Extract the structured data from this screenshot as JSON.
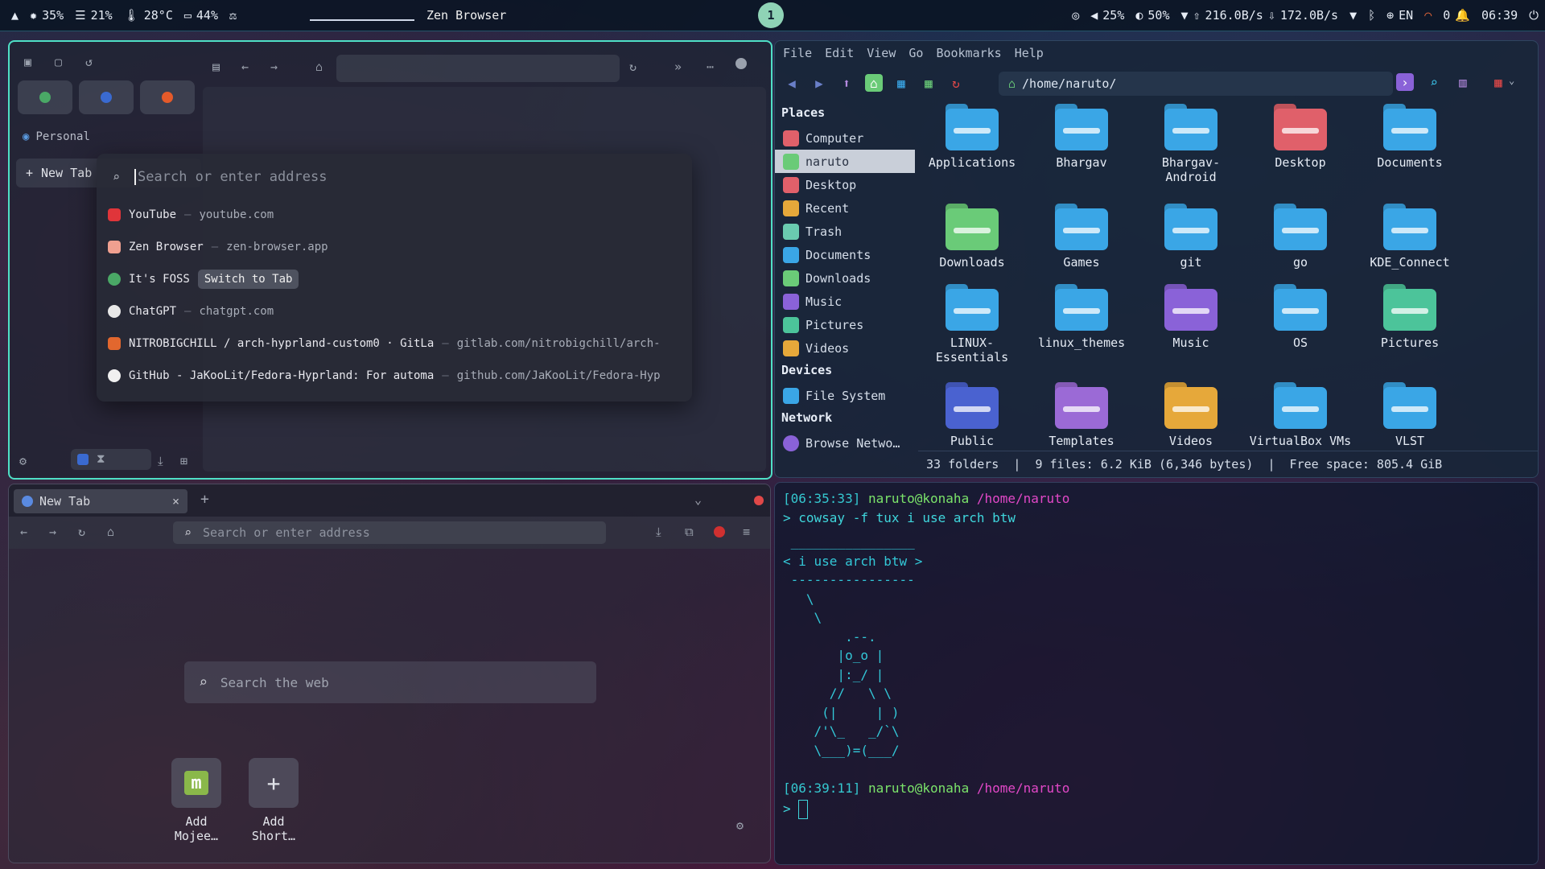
{
  "topbar": {
    "cpu": "35%",
    "mem": "21%",
    "temp": "28°C",
    "battery": "44%",
    "window_title": "Zen Browser",
    "workspace": "1",
    "volume": "25%",
    "brightness": "50%",
    "net_down": "216.0B/s",
    "net_up": "172.0B/s",
    "lang": "EN",
    "notifications": "0",
    "clock": "06:39"
  },
  "zen": {
    "workspace_label": "Personal",
    "new_tab_label": "New Tab",
    "search_placeholder": "Search or enter address",
    "suggestions": [
      {
        "title": "YouTube",
        "url": "youtube.com",
        "color": "#e0353a"
      },
      {
        "title": "Zen Browser",
        "url": "zen-browser.app",
        "color": "#f0a090"
      },
      {
        "title": "It's FOSS",
        "button": "Switch to Tab",
        "color": "#4aa866"
      },
      {
        "title": "ChatGPT",
        "url": "chatgpt.com",
        "color": "#e8e8e8"
      },
      {
        "title": "NITROBIGCHILL / arch-hyprland-custom0 · GitLa",
        "url": "gitlab.com/nitrobigchill/arch-",
        "color": "#e2672e"
      },
      {
        "title": "GitHub - JaKooLit/Fedora-Hyprland: For automa",
        "url": "github.com/JaKooLit/Fedora-Hyp",
        "color": "#f0f0f0"
      }
    ]
  },
  "fm": {
    "menu": [
      "File",
      "Edit",
      "View",
      "Go",
      "Bookmarks",
      "Help"
    ],
    "path": "/home/naruto/",
    "places_header": "Places",
    "places": [
      "Computer",
      "naruto",
      "Desktop",
      "Recent",
      "Trash",
      "Documents",
      "Downloads",
      "Music",
      "Pictures",
      "Videos"
    ],
    "devices_header": "Devices",
    "devices": [
      "File System"
    ],
    "network_header": "Network",
    "network": [
      "Browse Netwo…"
    ],
    "folders": [
      {
        "name": "Applications",
        "color": "#3aa6e6"
      },
      {
        "name": "Bhargav",
        "color": "#3aa6e6"
      },
      {
        "name": "Bhargav-\nAndroid",
        "color": "#3aa6e6"
      },
      {
        "name": "Desktop",
        "color": "#e0606a"
      },
      {
        "name": "Documents",
        "color": "#3aa6e6"
      },
      {
        "name": "Downloads",
        "color": "#6acb78"
      },
      {
        "name": "Games",
        "color": "#3aa6e6"
      },
      {
        "name": "git",
        "color": "#3aa6e6"
      },
      {
        "name": "go",
        "color": "#3aa6e6"
      },
      {
        "name": "KDE_Connect",
        "color": "#3aa6e6"
      },
      {
        "name": "LINUX-\nEssentials",
        "color": "#3aa6e6"
      },
      {
        "name": "linux_themes",
        "color": "#3aa6e6"
      },
      {
        "name": "Music",
        "color": "#8a62d8"
      },
      {
        "name": "OS",
        "color": "#3aa6e6"
      },
      {
        "name": "Pictures",
        "color": "#4cc49a"
      },
      {
        "name": "Public",
        "color": "#4a62d0"
      },
      {
        "name": "Templates",
        "color": "#9b6ad6"
      },
      {
        "name": "Videos",
        "color": "#e6a83a"
      },
      {
        "name": "VirtualBox VMs",
        "color": "#3aa6e6"
      },
      {
        "name": "VLST",
        "color": "#3aa6e6"
      }
    ],
    "status": "33 folders  |  9 files: 6.2 KiB (6,346 bytes)  |  Free space: 805.4 GiB"
  },
  "ff": {
    "tab_label": "New Tab",
    "address_placeholder": "Search or enter address",
    "web_search_placeholder": "Search the web",
    "shortcuts": [
      "Add Mojee…",
      "Add Short…"
    ]
  },
  "term": {
    "prompt1_time": "[06:35:33]",
    "user_host": "naruto@konaha",
    "cwd": "/home/naruto",
    "command": "> cowsay -f tux i use arch btw",
    "cow": " ________________\n< i use arch btw >\n ----------------\n   \\\n    \\\n        .--.\n       |o_o |\n       |:_/ |\n      //   \\ \\\n     (|     | )\n    /'\\_   _/`\\\n    \\___)=(___/",
    "prompt2_time": "[06:39:11]",
    "prompt_char": ">"
  }
}
